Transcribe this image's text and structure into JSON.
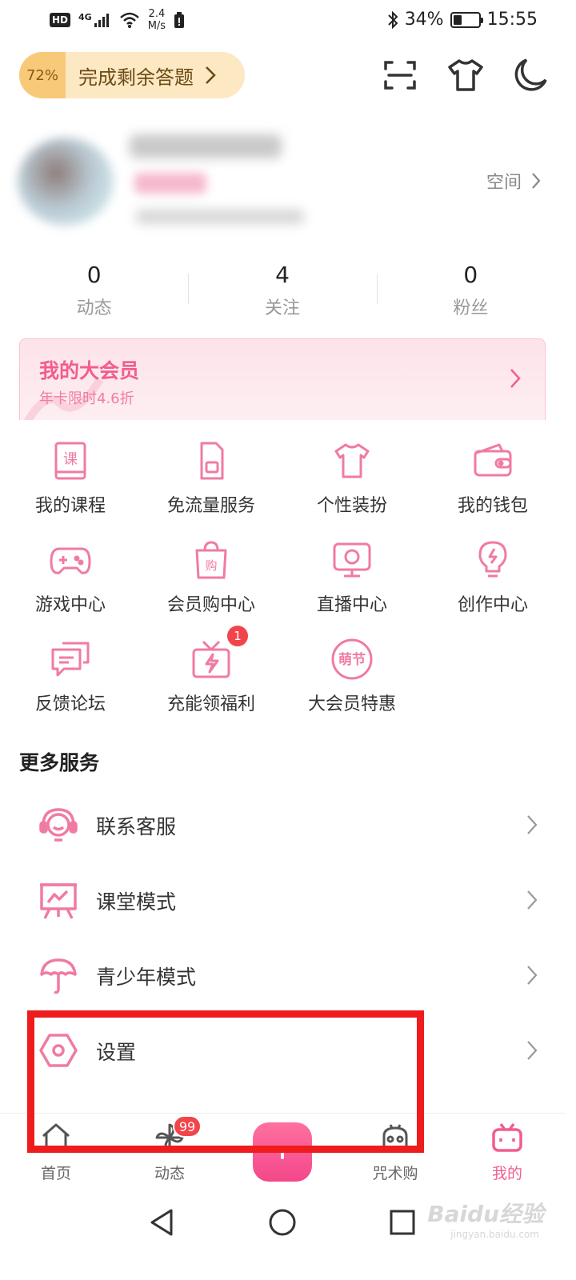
{
  "status_bar": {
    "hd": "HD",
    "signal_type": "4G",
    "speed_value": "2.4",
    "speed_unit": "M/s",
    "battery": "34%",
    "battery_level": 0.34,
    "time": "15:55"
  },
  "quiz": {
    "percent": "72%",
    "label": "完成剩余答题",
    "chevron": "›"
  },
  "header_icons": [
    "scan-icon",
    "tshirt-icon",
    "moon-icon"
  ],
  "profile": {
    "space_label": "空间"
  },
  "stats": [
    {
      "value": "0",
      "label": "动态"
    },
    {
      "value": "4",
      "label": "关注"
    },
    {
      "value": "0",
      "label": "粉丝"
    }
  ],
  "vip": {
    "title": "我的大会员",
    "subtitle": "年卡限时4.6折"
  },
  "grid": [
    {
      "label": "我的课程",
      "icon": "course-book-icon"
    },
    {
      "label": "免流量服务",
      "icon": "sim-card-icon"
    },
    {
      "label": "个性装扮",
      "icon": "tshirt-icon"
    },
    {
      "label": "我的钱包",
      "icon": "wallet-icon"
    },
    {
      "label": "游戏中心",
      "icon": "gamepad-icon"
    },
    {
      "label": "会员购中心",
      "icon": "shopping-bag-icon"
    },
    {
      "label": "直播中心",
      "icon": "live-tv-icon"
    },
    {
      "label": "创作中心",
      "icon": "lightbulb-icon"
    },
    {
      "label": "反馈论坛",
      "icon": "chat-bubbles-icon"
    },
    {
      "label": "充能领福利",
      "icon": "gift-bolt-icon",
      "badge": "1"
    },
    {
      "label": "大会员特惠",
      "icon": "festival-badge-icon",
      "icon_text": "萌节"
    }
  ],
  "more_services": {
    "title": "更多服务",
    "items": [
      {
        "label": "联系客服",
        "icon": "headset-icon"
      },
      {
        "label": "课堂模式",
        "icon": "classroom-board-icon"
      },
      {
        "label": "青少年模式",
        "icon": "umbrella-icon"
      },
      {
        "label": "设置",
        "icon": "settings-hex-icon"
      }
    ]
  },
  "bottom_nav": [
    {
      "label": "首页",
      "icon": "home-icon"
    },
    {
      "label": "动态",
      "icon": "pinwheel-icon",
      "badge": "99"
    },
    {
      "label": "咒术购",
      "icon": "shop-robot-icon"
    },
    {
      "label": "我的",
      "icon": "tv-mascot-icon",
      "active": true
    }
  ],
  "colors": {
    "accent": "#f25d8e",
    "highlight_box": "#ee1c1c"
  },
  "watermark": {
    "brand": "Baidu经验",
    "url": "jingyan.baidu.com"
  }
}
